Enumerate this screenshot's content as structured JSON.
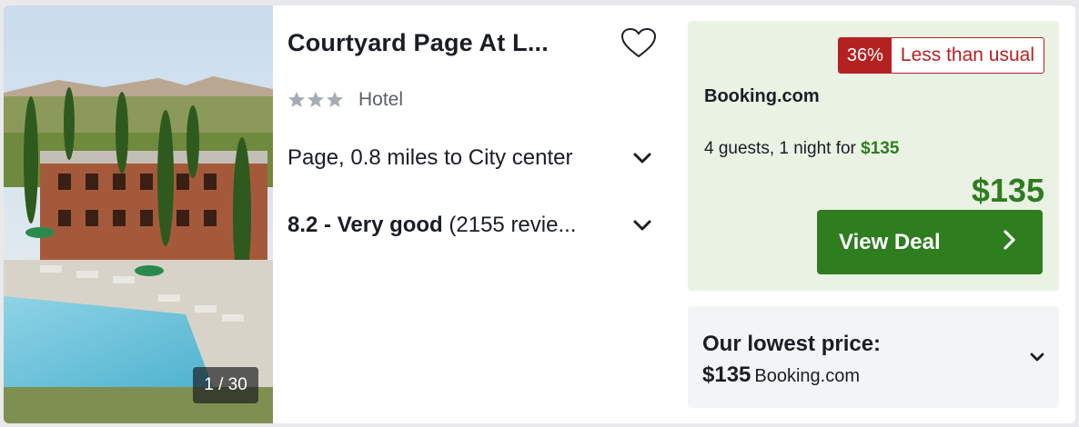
{
  "photo": {
    "counter": "1 / 30"
  },
  "hotel": {
    "name": "Courtyard Page At L...",
    "star_count": 3,
    "type": "Hotel",
    "location": "Page, 0.8 miles to City center",
    "rating_bold": "8.2 - Very good",
    "rating_rest": " (2155 revie..."
  },
  "deal": {
    "discount_pct": "36%",
    "discount_label": "Less than usual",
    "provider": "Booking.com",
    "stay_text": "4 guests, 1 night for ",
    "stay_price": "$135",
    "price": "$135",
    "button_label": "View Deal"
  },
  "lowest": {
    "title": "Our lowest price:",
    "price": "$135",
    "provider": "Booking.com"
  },
  "colors": {
    "accent_green": "#2e7d1f",
    "discount_red": "#b52121",
    "deal_bg": "#eaf2e4"
  },
  "icons": [
    "heart-icon",
    "star-icon",
    "chevron-down-icon",
    "chevron-right-icon"
  ]
}
